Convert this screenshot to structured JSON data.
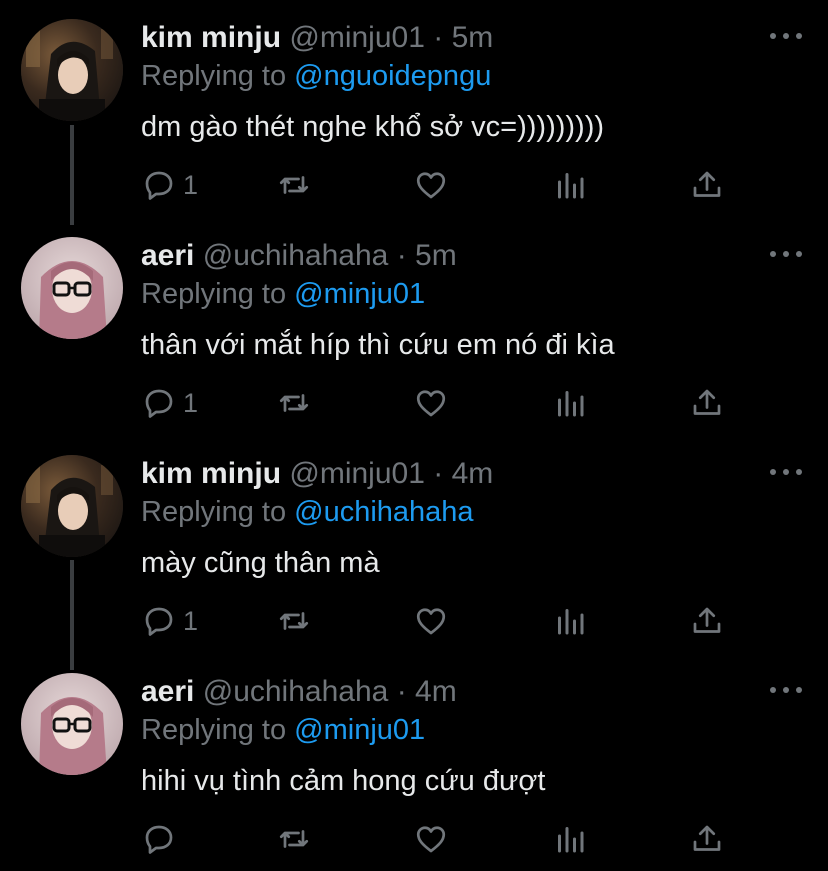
{
  "colors": {
    "background": "#000000",
    "primary_text": "#e7e9ea",
    "secondary_text": "#71767b",
    "link": "#1d9bf0",
    "thread_line": "#3a3d40"
  },
  "action_icons": [
    "reply-icon",
    "retweet-icon",
    "like-icon",
    "analytics-icon",
    "share-icon"
  ],
  "tweets": [
    {
      "name": "kim minju",
      "handle": "@minju01",
      "separator": "·",
      "time": "5m",
      "replying_label": "Replying to",
      "replying_to": "@nguoidepngu",
      "text": "dm gào thét nghe khổ sở vc=)))))))))",
      "reply_count": "1",
      "avatar": "kim-minju-avatar"
    },
    {
      "name": "aeri",
      "handle": "@uchihahaha",
      "separator": "·",
      "time": "5m",
      "replying_label": "Replying to",
      "replying_to": "@minju01",
      "text": "thân với mắt híp thì cứu em nó đi kìa",
      "reply_count": "1",
      "avatar": "aeri-avatar"
    },
    {
      "name": "kim minju",
      "handle": "@minju01",
      "separator": "·",
      "time": "4m",
      "replying_label": "Replying to",
      "replying_to": "@uchihahaha",
      "text": "mày cũng thân mà",
      "reply_count": "1",
      "avatar": "kim-minju-avatar"
    },
    {
      "name": "aeri",
      "handle": "@uchihahaha",
      "separator": "·",
      "time": "4m",
      "replying_label": "Replying to",
      "replying_to": "@minju01",
      "text": "hihi vụ tình cảm hong cứu đượt",
      "reply_count": "",
      "avatar": "aeri-avatar"
    }
  ]
}
